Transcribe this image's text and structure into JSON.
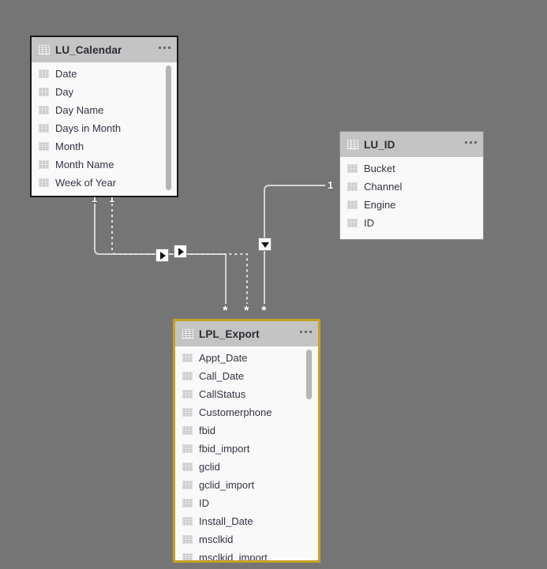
{
  "canvas": {
    "background_color": "#757575",
    "view_name": "model-view"
  },
  "tables": [
    {
      "id": "lu_calendar",
      "name": "LU_Calendar",
      "selected": false,
      "header_icon": "table-icon",
      "menu_icon": "more-options-icon",
      "fields": [
        {
          "name": "Date",
          "icon": "table-field-icon"
        },
        {
          "name": "Day",
          "icon": "table-field-icon"
        },
        {
          "name": "Day Name",
          "icon": "table-field-icon"
        },
        {
          "name": "Days in Month",
          "icon": "table-field-icon"
        },
        {
          "name": "Month",
          "icon": "table-field-icon"
        },
        {
          "name": "Month Name",
          "icon": "table-field-icon"
        },
        {
          "name": "Week of Year",
          "icon": "table-field-icon"
        }
      ],
      "scrollbar": {
        "visible": true
      }
    },
    {
      "id": "lu_id",
      "name": "LU_ID",
      "selected": false,
      "header_icon": "table-icon",
      "menu_icon": "more-options-icon",
      "fields": [
        {
          "name": "Bucket",
          "icon": "table-field-icon"
        },
        {
          "name": "Channel",
          "icon": "table-field-icon"
        },
        {
          "name": "Engine",
          "icon": "table-field-icon"
        },
        {
          "name": "ID",
          "icon": "table-field-icon"
        }
      ],
      "scrollbar": {
        "visible": false
      }
    },
    {
      "id": "lpl_export",
      "name": "LPL_Export",
      "selected": true,
      "selection_color": "#c8a020",
      "header_icon": "table-icon",
      "menu_icon": "more-options-icon",
      "fields": [
        {
          "name": "Appt_Date",
          "icon": "table-field-icon"
        },
        {
          "name": "Call_Date",
          "icon": "table-field-icon"
        },
        {
          "name": "CallStatus",
          "icon": "table-field-icon"
        },
        {
          "name": "Customerphone",
          "icon": "table-field-icon"
        },
        {
          "name": "fbid",
          "icon": "table-field-icon"
        },
        {
          "name": "fbid_import",
          "icon": "table-field-icon"
        },
        {
          "name": "gclid",
          "icon": "table-field-icon"
        },
        {
          "name": "gclid_import",
          "icon": "table-field-icon"
        },
        {
          "name": "ID",
          "icon": "table-field-icon"
        },
        {
          "name": "Install_Date",
          "icon": "table-field-icon"
        },
        {
          "name": "msclkid",
          "icon": "table-field-icon"
        },
        {
          "name": "msclkid_import",
          "icon": "table-field-icon"
        }
      ],
      "scrollbar": {
        "visible": true
      }
    }
  ],
  "relationships": [
    {
      "id": "rel-calendar-solid",
      "from_table": "LU_Calendar",
      "to_table": "LPL_Export",
      "from_cardinality": "1",
      "to_cardinality": "*",
      "style": "solid",
      "active": true,
      "cross_filter_icon": "arrow-right-icon"
    },
    {
      "id": "rel-calendar-dotted",
      "from_table": "LU_Calendar",
      "to_table": "LPL_Export",
      "from_cardinality": "1",
      "to_cardinality": "*",
      "style": "dotted",
      "active": false,
      "cross_filter_icon": "arrow-right-icon"
    },
    {
      "id": "rel-luid-solid",
      "from_table": "LU_ID",
      "to_table": "LPL_Export",
      "from_cardinality": "1",
      "to_cardinality": "*",
      "style": "solid",
      "active": true,
      "cross_filter_icon": "arrow-down-icon"
    }
  ],
  "markers": {
    "one": "1",
    "many": "*"
  }
}
